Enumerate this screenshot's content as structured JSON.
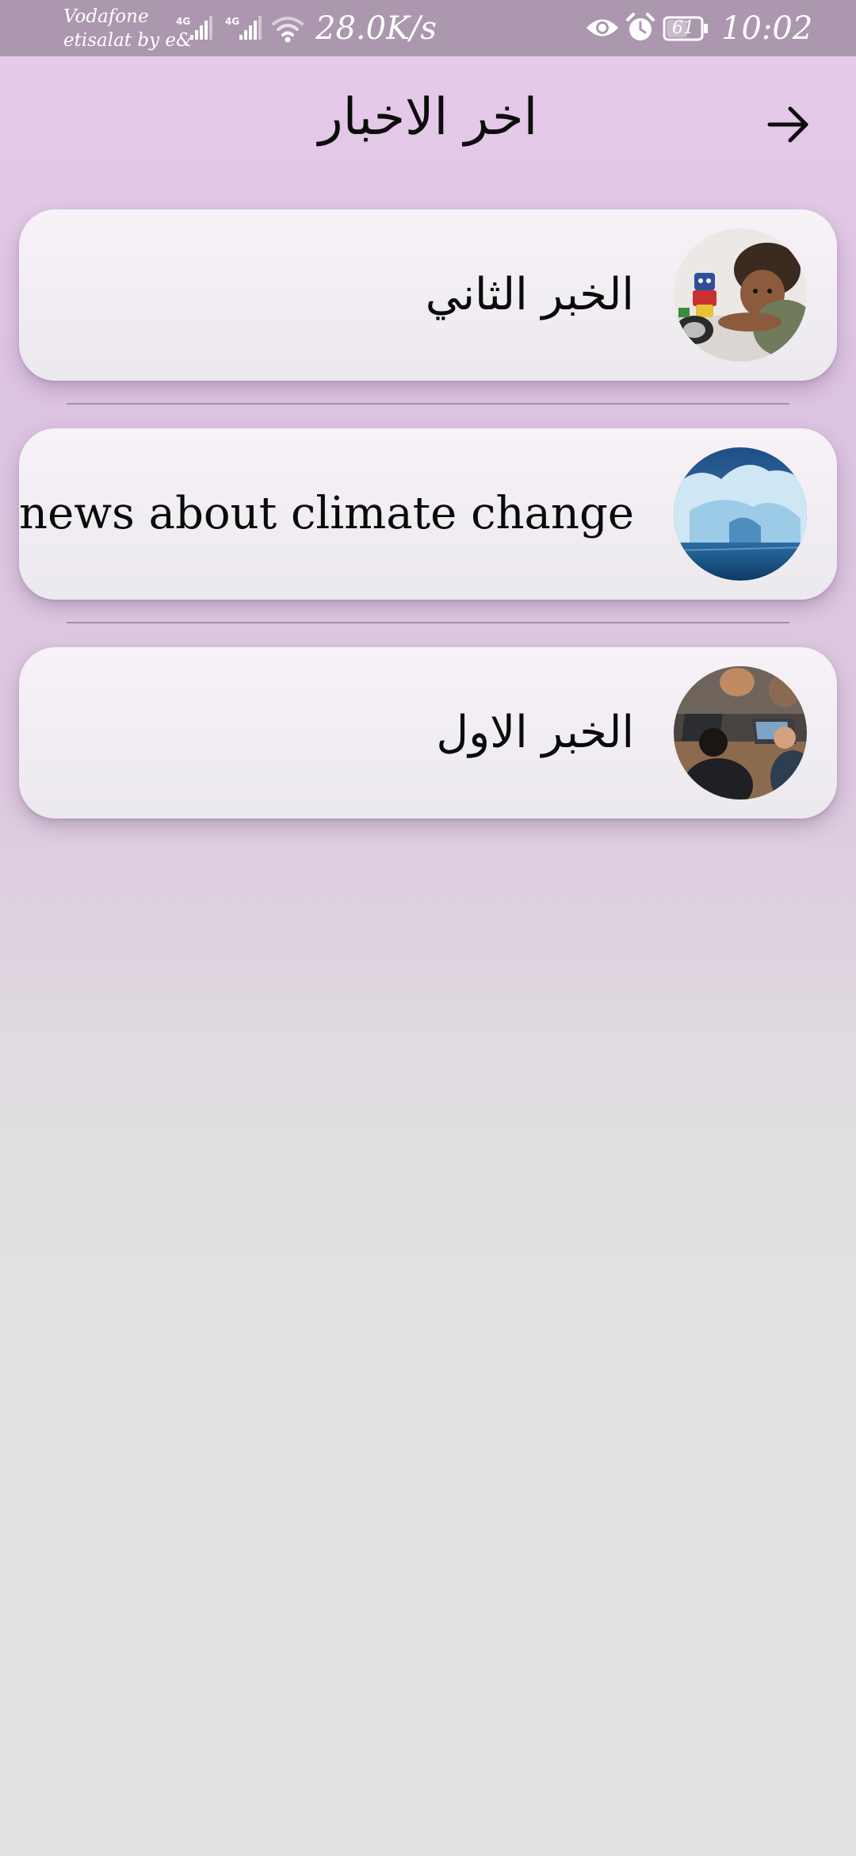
{
  "status_bar": {
    "carrier_line1": "Vodafone",
    "carrier_line2": "etisalat by e&",
    "signal_type_1": "4G",
    "signal_type_2": "4G",
    "net_speed": "28.0K/s",
    "battery_level": "61",
    "time": "10:02",
    "icons": [
      "signal-icon",
      "wifi-icon",
      "eye-icon",
      "alarm-icon",
      "battery-icon"
    ]
  },
  "header": {
    "title": "اخر الاخبار",
    "back_icon": "arrow-right-icon"
  },
  "news": [
    {
      "title": "الخبر الثاني",
      "image": "child-with-toy-robot"
    },
    {
      "title": "news about climate change",
      "image": "iceberg"
    },
    {
      "title": "الخبر الاول",
      "image": "people-with-laptops"
    }
  ],
  "colors": {
    "status_bar_bg": "#ab97ae",
    "card_bg": "#f1eef3",
    "text": "#0a0a0a",
    "divider": "#a493a8"
  }
}
